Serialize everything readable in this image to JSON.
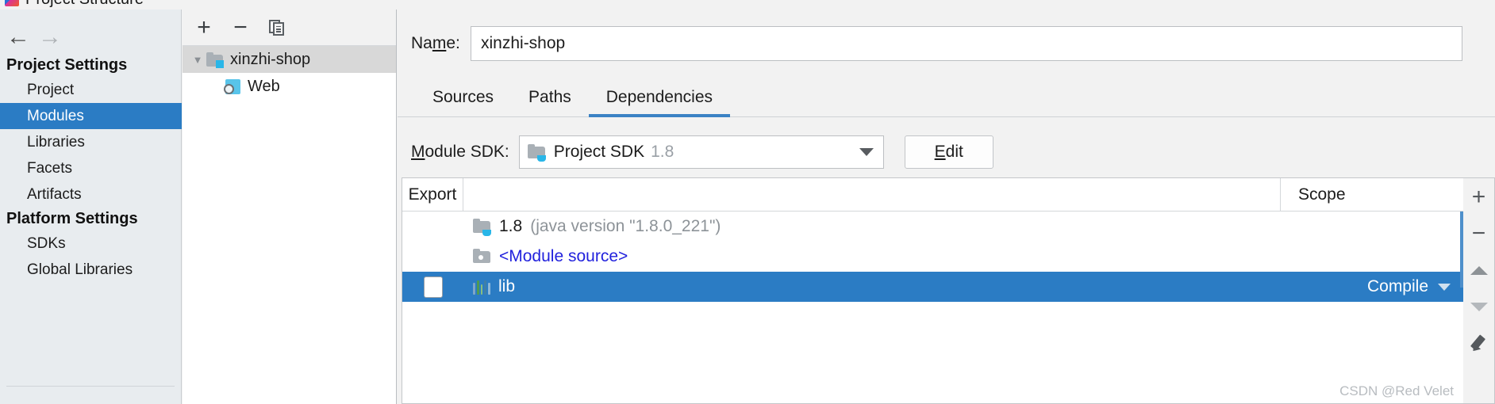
{
  "window": {
    "title": "Project Structure",
    "app_icon": "intellij-idea-icon"
  },
  "nav": {
    "back_icon": "arrow-left-icon",
    "forward_icon": "arrow-right-icon"
  },
  "sidebar": {
    "groups": [
      {
        "title": "Project Settings",
        "items": [
          {
            "label": "Project",
            "selected": false
          },
          {
            "label": "Modules",
            "selected": true
          },
          {
            "label": "Libraries",
            "selected": false
          },
          {
            "label": "Facets",
            "selected": false
          },
          {
            "label": "Artifacts",
            "selected": false
          }
        ]
      },
      {
        "title": "Platform Settings",
        "items": [
          {
            "label": "SDKs",
            "selected": false
          },
          {
            "label": "Global Libraries",
            "selected": false
          }
        ]
      }
    ]
  },
  "module_tree": {
    "toolbar": {
      "add_icon": "plus-icon",
      "remove_icon": "minus-icon",
      "copy_icon": "copy-icon"
    },
    "nodes": [
      {
        "label": "xinzhi-shop",
        "icon": "module-folder-icon",
        "expanded": true,
        "selected": true
      },
      {
        "label": "Web",
        "icon": "web-facet-icon",
        "expanded": false,
        "selected": false
      }
    ]
  },
  "name_field": {
    "label": "Name:",
    "label_mnemonic": "m",
    "value": "xinzhi-shop",
    "placeholder": ""
  },
  "tabs": [
    {
      "label": "Sources",
      "active": false
    },
    {
      "label": "Paths",
      "active": false
    },
    {
      "label": "Dependencies",
      "active": true
    }
  ],
  "module_sdk": {
    "label": "Module SDK:",
    "label_mnemonic": "M",
    "value_name": "Project SDK",
    "value_version": "1.8",
    "icon": "jdk-folder-icon",
    "dropdown_icon": "chevron-down-icon",
    "edit_button": "Edit",
    "edit_mnemonic": "E"
  },
  "dependencies": {
    "columns": [
      "Export",
      "",
      "Scope"
    ],
    "rows": [
      {
        "icon": "jdk-folder-icon",
        "checkbox": null,
        "name": "1.8",
        "detail": "(java version \"1.8.0_221\")",
        "scope": "",
        "selected": false,
        "link": false
      },
      {
        "icon": "module-source-icon",
        "checkbox": null,
        "name": "<Module source>",
        "detail": "",
        "scope": "",
        "selected": false,
        "link": true
      },
      {
        "icon": "library-icon",
        "checkbox": false,
        "name": "lib",
        "detail": "",
        "scope": "Compile",
        "selected": true,
        "link": false
      }
    ],
    "toolbar": {
      "add_icon": "plus-icon",
      "remove_icon": "minus-icon",
      "move_up_icon": "triangle-up-icon",
      "move_down_icon": "triangle-down-icon",
      "edit_icon": "pencil-icon"
    }
  },
  "watermark": "CSDN @Red Velet",
  "colors": {
    "selection_blue": "#2b7cc4",
    "tab_underline": "#3b82c4",
    "link_blue": "#2222dd",
    "panel_bg": "#f2f2f2",
    "sidebar_bg": "#e8ecef"
  }
}
